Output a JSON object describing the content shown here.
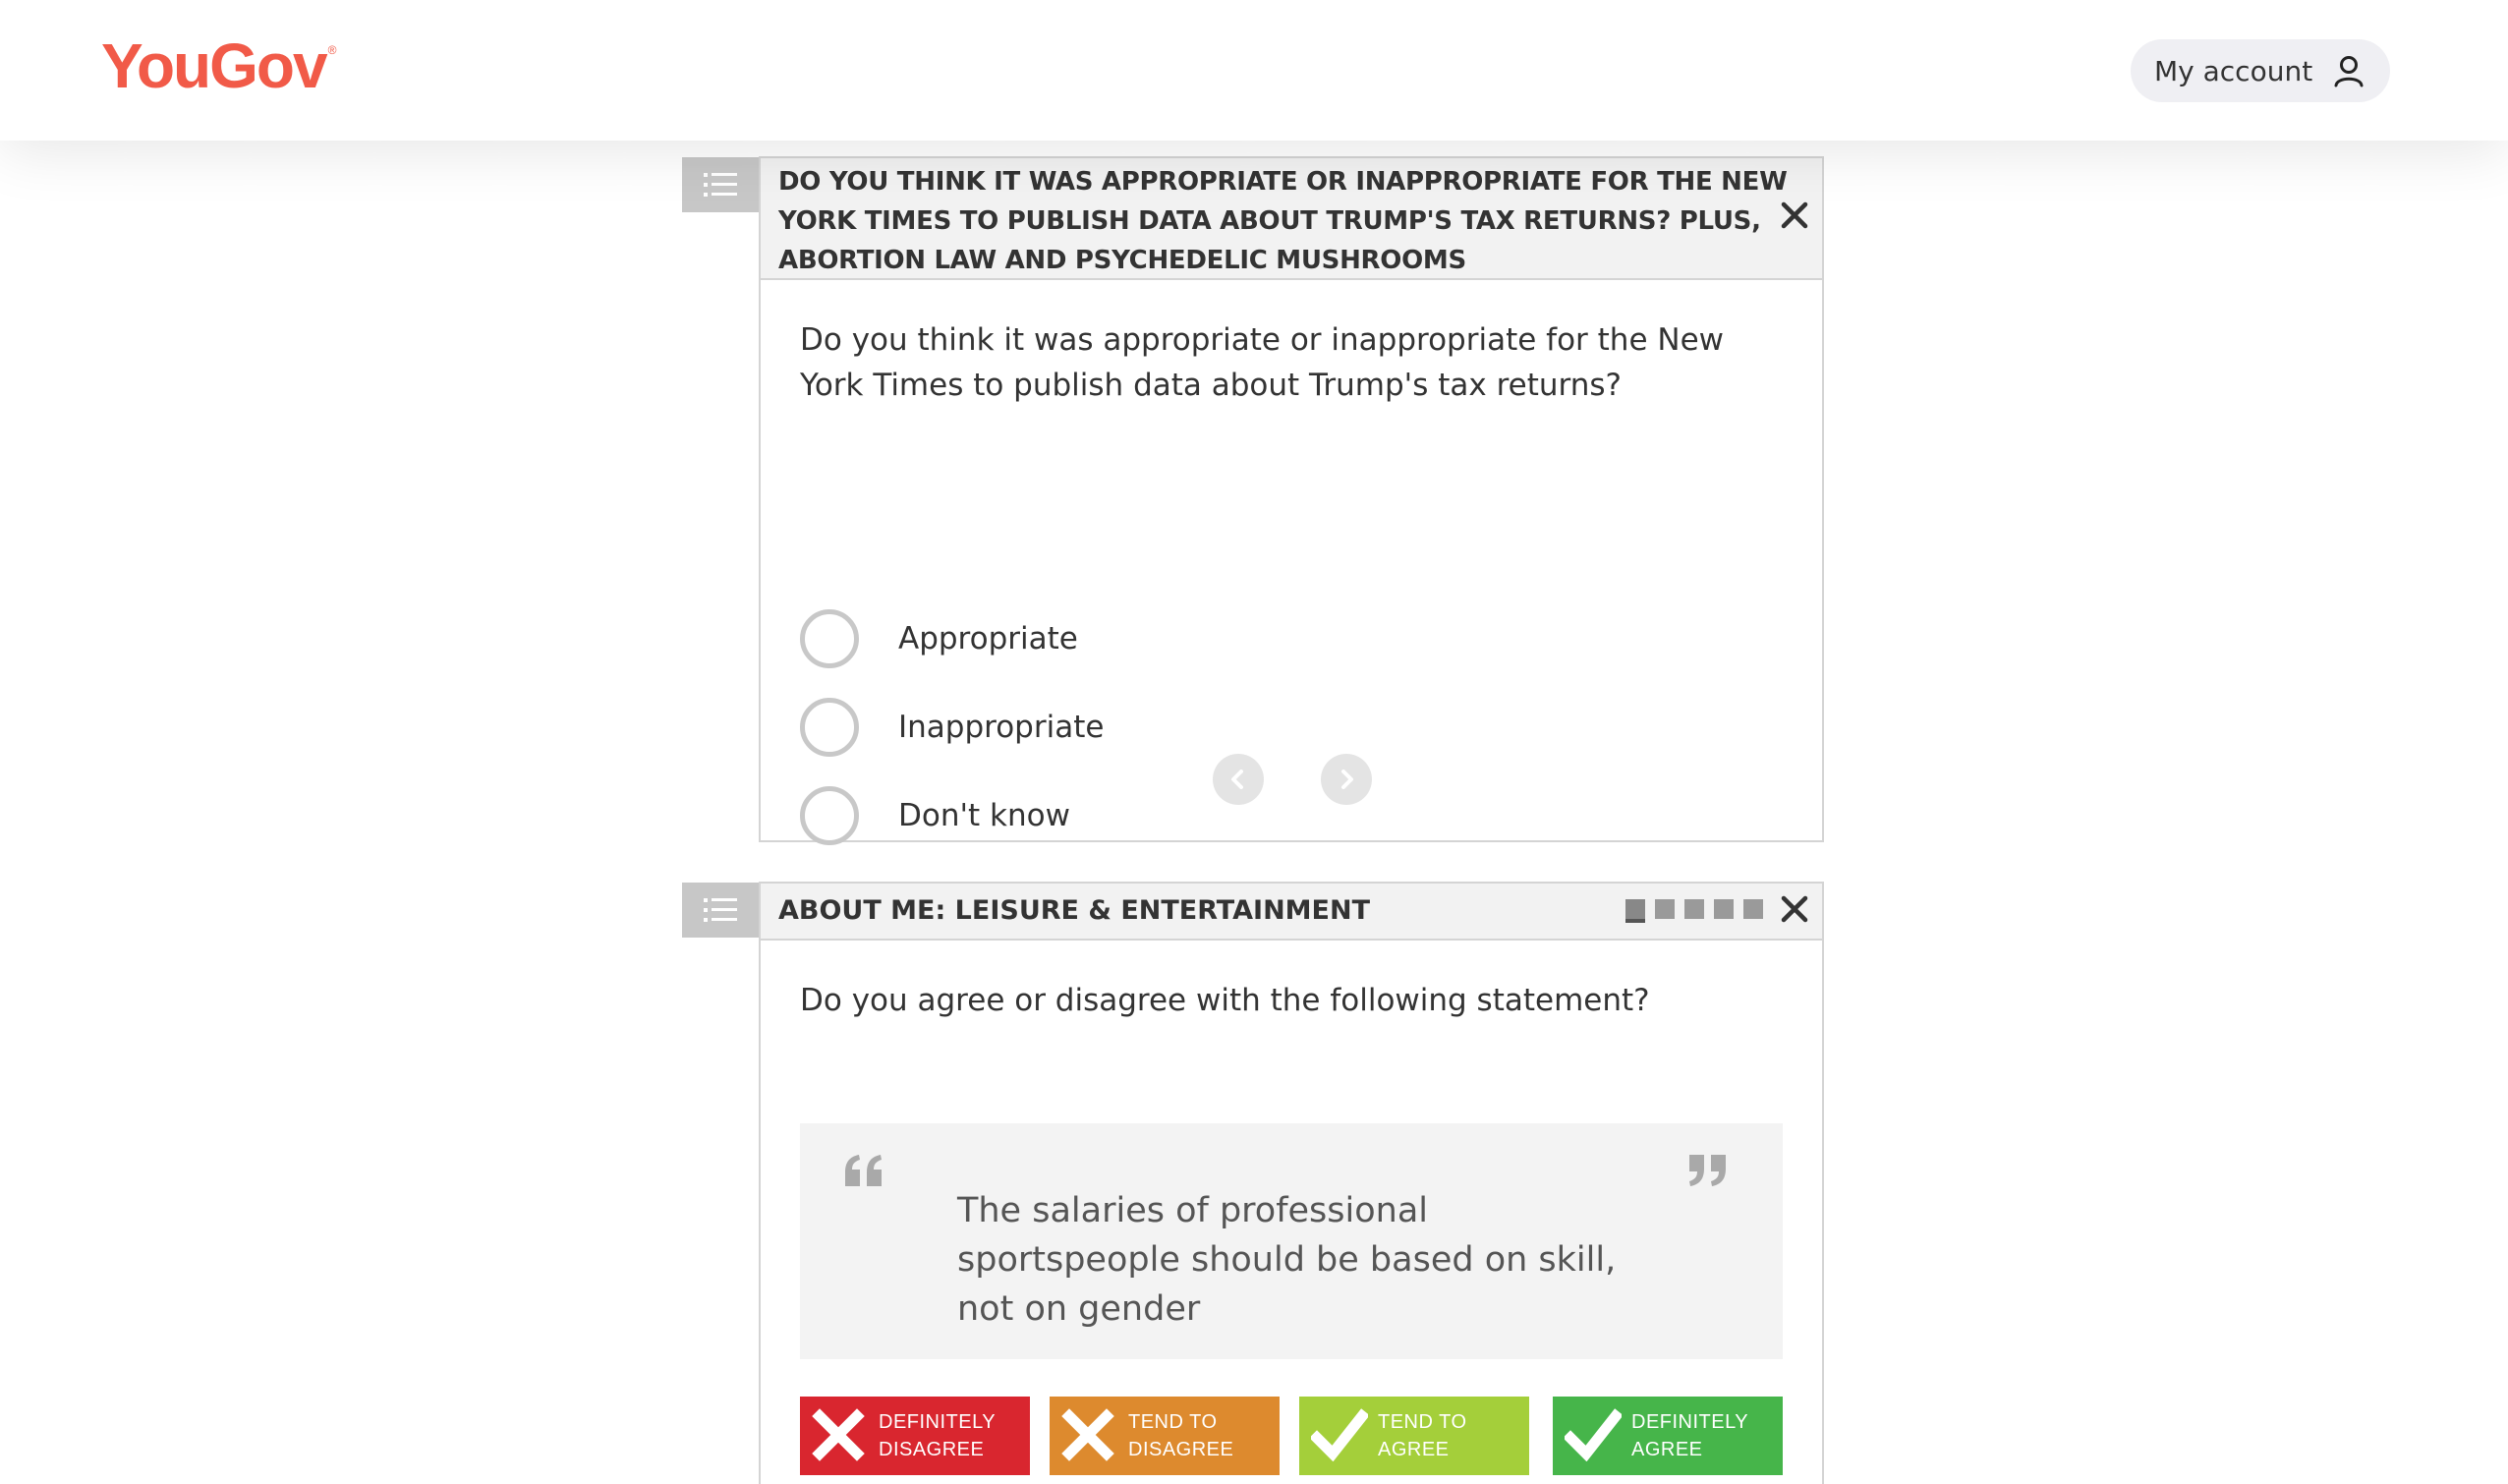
{
  "header": {
    "logo": "YouGov",
    "logo_mark": "®",
    "account_label": "My account",
    "brand_color": "#f15a48"
  },
  "survey1": {
    "title": "DO YOU THINK IT WAS APPROPRIATE OR INAPPROPRIATE FOR THE NEW YORK TIMES TO PUBLISH DATA ABOUT TRUMP'S TAX RETURNS? PLUS, ABORTION LAW AND PSYCHEDELIC MUSHROOMS",
    "question": "Do you think it was appropriate or inappropriate for the New York Times to publish data about Trump's tax returns?",
    "options": [
      {
        "label": "Appropriate",
        "selected": false
      },
      {
        "label": "Inappropriate",
        "selected": false
      },
      {
        "label": "Don't know",
        "selected": false
      }
    ],
    "nav": {
      "prev_icon": "chevron-left-icon",
      "next_icon": "chevron-right-icon"
    }
  },
  "survey2": {
    "title": "ABOUT ME: LEISURE & ENTERTAINMENT",
    "progress": {
      "total": 5,
      "current": 1
    },
    "question": "Do you agree or disagree with the following statement?",
    "statement": "The salaries of professional sportspeople should be based on skill, not on gender",
    "answers": [
      {
        "line1": "DEFINITELY",
        "line2": "DISAGREE",
        "color": "#d9262f",
        "icon": "cross-icon"
      },
      {
        "line1": "TEND TO",
        "line2": "DISAGREE",
        "color": "#dd8a2e",
        "icon": "cross-icon"
      },
      {
        "line1": "TEND TO",
        "line2": "AGREE",
        "color": "#a4cf3a",
        "icon": "check-icon"
      },
      {
        "line1": "DEFINITELY",
        "line2": "AGREE",
        "color": "#46b54a",
        "icon": "check-icon"
      }
    ]
  }
}
